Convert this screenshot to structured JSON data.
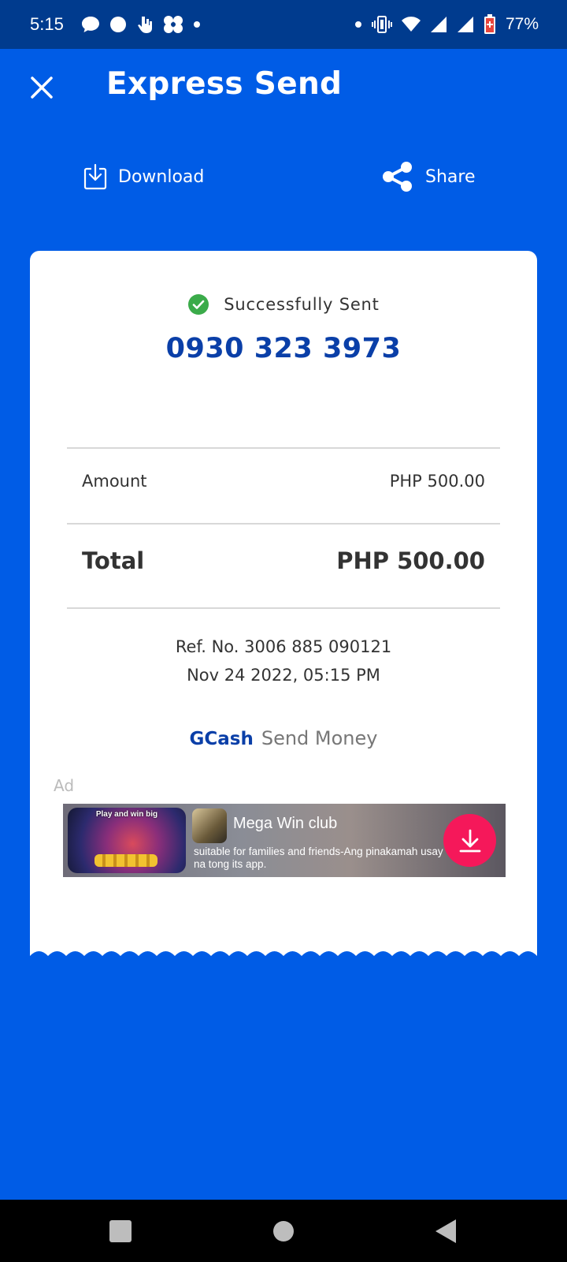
{
  "status_bar": {
    "time": "5:15",
    "battery_percent": "77%",
    "left_icons": [
      "chat-bubble-icon",
      "circle-app-icon",
      "hand-app-icon",
      "fan-app-icon",
      "dot-icon"
    ],
    "right_icons": [
      "dot-icon",
      "vibrate-icon",
      "wifi-icon",
      "signal-icon",
      "signal-icon",
      "battery-icon"
    ]
  },
  "app_bar": {
    "title": "Express Send",
    "close_icon": "close-icon"
  },
  "actions": {
    "download_label": "Download",
    "share_label": "Share"
  },
  "receipt": {
    "status_text": "Successfully Sent",
    "recipient_number": "0930 323 3973",
    "amount_label": "Amount",
    "amount_value": "PHP 500.00",
    "total_label": "Total",
    "total_value": "PHP 500.00",
    "reference": "Ref. No. 3006 885 090121",
    "datetime": "Nov 24 2022, 05:15 PM",
    "brand_name": "GCash",
    "service_name": "Send Money"
  },
  "ad": {
    "label": "Ad",
    "thumbnail_text": "Play and win big",
    "app_name": "Mega Win club",
    "description": "suitable for families and friends-Ang pinakamah usay na tong its app."
  },
  "colors": {
    "background": "#005ce6",
    "status_bar": "#003b8e",
    "accent_text": "#0a3fa8",
    "success": "#3bab4a",
    "ad_button": "#f5185a"
  }
}
